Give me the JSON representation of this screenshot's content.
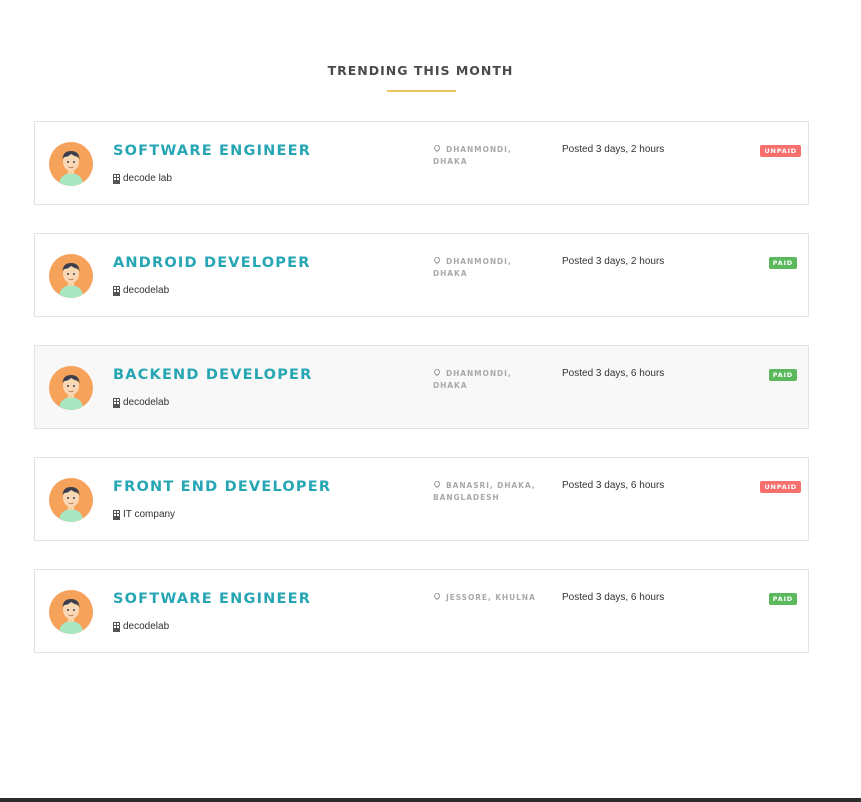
{
  "section": {
    "title": "TRENDING THIS MONTH"
  },
  "colors": {
    "accent": "#26a6b4",
    "underline": "#f0c262",
    "paid": "#5cb85c",
    "unpaid": "#f7706e"
  },
  "jobs": [
    {
      "title": "SOFTWARE ENGINEER",
      "company": "decode lab",
      "location": "DHANMONDI, DHAKA",
      "posted": "Posted 3 days, 2 hours",
      "status": "UNPAID",
      "avatar_icon": "developer-avatar-icon",
      "company_icon": "building-icon",
      "location_icon": "map-pin-icon"
    },
    {
      "title": "ANDROID DEVELOPER",
      "company": "decodelab",
      "location": "DHANMONDI, DHAKA",
      "posted": "Posted 3 days, 2 hours",
      "status": "PAID",
      "avatar_icon": "developer-avatar-icon",
      "company_icon": "building-icon",
      "location_icon": "map-pin-icon"
    },
    {
      "title": "BACKEND DEVELOPER",
      "company": "decodelab",
      "location": "DHANMONDI, DHAKA",
      "posted": "Posted 3 days, 6 hours",
      "status": "PAID",
      "avatar_icon": "developer-avatar-icon",
      "company_icon": "building-icon",
      "location_icon": "map-pin-icon"
    },
    {
      "title": "FRONT END DEVELOPER",
      "company": "IT company",
      "location": "BANASRI, DHAKA, BANGLADESH",
      "posted": "Posted 3 days, 6 hours",
      "status": "UNPAID",
      "avatar_icon": "developer-avatar-icon",
      "company_icon": "building-icon",
      "location_icon": "map-pin-icon"
    },
    {
      "title": "SOFTWARE ENGINEER",
      "company": "decodelab",
      "location": "JESSORE, KHULNA",
      "posted": "Posted 3 days, 6 hours",
      "status": "PAID",
      "avatar_icon": "developer-avatar-icon",
      "company_icon": "building-icon",
      "location_icon": "map-pin-icon"
    }
  ]
}
